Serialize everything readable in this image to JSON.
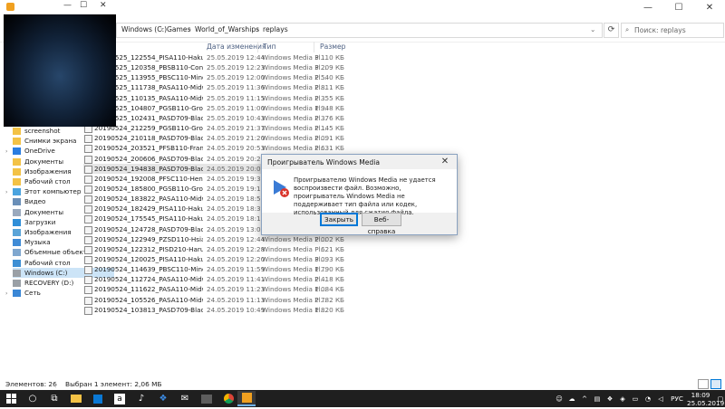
{
  "address": {
    "crumbs": [
      "Windows (C:)",
      "Games",
      "World_of_Warships",
      "replays"
    ],
    "search_placeholder": "Поиск: replays"
  },
  "columns": {
    "name": "",
    "date": "Дата изменения",
    "type": "Тип",
    "size": "Размер"
  },
  "files": [
    {
      "name": "20190525_122554_PISA110-Hakuryu_47_...",
      "date": "25.05.2019 12:44",
      "type": "Windows Media Pl...",
      "size": "3 110 КБ"
    },
    {
      "name": "20190525_120358_PBSB110-Conqueror_5...",
      "date": "25.05.2019 12:23",
      "type": "Windows Media Pl...",
      "size": "3 209 КБ"
    },
    {
      "name": "20190525_113955_PBSC110-Minotaur_35...",
      "date": "25.05.2019 12:00",
      "type": "Windows Media Pl...",
      "size": "2 540 КБ"
    },
    {
      "name": "20190525_111738_PASA110-Midway_45_...",
      "date": "25.05.2019 11:36",
      "type": "Windows Media Pl...",
      "size": "2 811 КБ"
    },
    {
      "name": "20190525_110135_PASA110-Midway_19_...",
      "date": "25.05.2019 11:15",
      "type": "Windows Media Pl...",
      "size": "2 355 КБ"
    },
    {
      "name": "20190525_104807_PGSB110-Grossdeutsc...",
      "date": "25.05.2019 11:00",
      "type": "Windows Media Pl...",
      "size": "1 948 КБ"
    },
    {
      "name": "20190525_102431_PASD709-Black_28_na...",
      "date": "25.05.2019 10:43",
      "type": "Windows Media Pl...",
      "size": "2 376 КБ"
    },
    {
      "name": "20190524_212259_PGSB110-Grossdeutsc...",
      "date": "24.05.2019 21:37",
      "type": "Windows Media Pl...",
      "size": "2 145 КБ"
    },
    {
      "name": "20190524_210118_PASD709-Black_16_OC...",
      "date": "24.05.2019 21:20",
      "type": "Windows Media Pl...",
      "size": "2 091 КБ"
    },
    {
      "name": "20190524_203521_PFSB110-France_50_G...",
      "date": "24.05.2019 20:53",
      "type": "Windows Media Pl...",
      "size": "2 631 КБ"
    },
    {
      "name": "20190524_200606_PASD709-Black_16_OC...",
      "date": "24.05.2019 20:22",
      "type": "Windows Media Pl...",
      "size": "2 140 КБ"
    },
    {
      "name": "20190524_194838_PASD709-Black_16_OC...",
      "date": "24.05.2019 20:03",
      "type": "Windows Media Pl...",
      "size": "2 112 КБ"
    },
    {
      "name": "20190524_192008_PFSC110-Henri-IV_18_...",
      "date": "24.05.2019 19:34",
      "type": "Windows Media Pl...",
      "size": "2 140 КБ"
    },
    {
      "name": "20190524_185800_PGSB110-Grossdeutsc...",
      "date": "24.05.2019 19:17",
      "type": "Windows Media Pl...",
      "size": "2 306 КБ"
    },
    {
      "name": "20190524_183822_PASA110-Midway_22_...",
      "date": "24.05.2019 18:56",
      "type": "Windows Media Pl...",
      "size": "2 222 КБ"
    },
    {
      "name": "20190524_182429_PISA110-Hakuryu_16_...",
      "date": "24.05.2019 18:32",
      "type": "Windows Media Pl...",
      "size": "1 760 КБ"
    },
    {
      "name": "20190524_175545_PISA110-Hakuryu_16_...",
      "date": "24.05.2019 18:16",
      "type": "Windows Media Pl...",
      "size": "2 100 КБ"
    },
    {
      "name": "20190524_124728_PASD709-Black_35_NE...",
      "date": "24.05.2019 13:03",
      "type": "Windows Media Pl...",
      "size": "2 429 КБ"
    },
    {
      "name": "20190524_122949_PZSD110-Hsiang-Yan...",
      "date": "24.05.2019 12:44",
      "type": "Windows Media Pl...",
      "size": "2 002 КБ"
    },
    {
      "name": "20190524_122312_PISD210-Harugumo_2...",
      "date": "24.05.2019 12:28",
      "type": "Windows Media Pl...",
      "size": "621 КБ"
    },
    {
      "name": "20190524_120025_PISA110-Hakuryu_35_...",
      "date": "24.05.2019 12:20",
      "type": "Windows Media Pl...",
      "size": "3 093 КБ"
    },
    {
      "name": "20190524_114639_PBSC110-Minotaur_00...",
      "date": "24.05.2019 11:59",
      "type": "Windows Media Pl...",
      "size": "1 790 КБ"
    },
    {
      "name": "20190524_112724_PASA110-Midway_38_...",
      "date": "24.05.2019 11:41",
      "type": "Windows Media Pl...",
      "size": "2 418 КБ"
    },
    {
      "name": "20190524_111622_PASA110-Midway_14_...",
      "date": "24.05.2019 11:23",
      "type": "Windows Media Pl...",
      "size": "1 084 КБ"
    },
    {
      "name": "20190524_105526_PASA110-Midway_18_...",
      "date": "24.05.2019 11:13",
      "type": "Windows Media Pl...",
      "size": "2 782 КБ"
    },
    {
      "name": "20190524_103813_PASD709-Black_44_Pat...",
      "date": "24.05.2019 10:49",
      "type": "Windows Media Pl...",
      "size": "1 820 КБ"
    }
  ],
  "sidebar": [
    {
      "label": "screenshot",
      "icon": "folder-icon",
      "chev": ""
    },
    {
      "label": "Снимки экрана",
      "icon": "folder-icon",
      "chev": ""
    },
    {
      "label": "OneDrive",
      "icon": "cloud-icon",
      "chev": "›"
    },
    {
      "label": "Документы",
      "icon": "folder-icon",
      "chev": ""
    },
    {
      "label": "Изображения",
      "icon": "folder-icon",
      "chev": ""
    },
    {
      "label": "Рабочий стол",
      "icon": "folder-icon",
      "chev": ""
    },
    {
      "label": "Этот компьютер",
      "icon": "computer-icon",
      "chev": "›"
    },
    {
      "label": "Видео",
      "icon": "video-folder-icon",
      "chev": ""
    },
    {
      "label": "Документы",
      "icon": "documents-folder-icon",
      "chev": ""
    },
    {
      "label": "Загрузки",
      "icon": "downloads-folder-icon",
      "chev": ""
    },
    {
      "label": "Изображения",
      "icon": "pictures-folder-icon",
      "chev": ""
    },
    {
      "label": "Музыка",
      "icon": "music-folder-icon",
      "chev": ""
    },
    {
      "label": "Объемные объекты",
      "icon": "3d-objects-icon",
      "chev": ""
    },
    {
      "label": "Рабочий стол",
      "icon": "desktop-folder-icon",
      "chev": ""
    },
    {
      "label": "Windows (C:)",
      "icon": "drive-icon",
      "chev": ""
    },
    {
      "label": "RECOVERY (D:)",
      "icon": "drive-icon",
      "chev": ""
    },
    {
      "label": "Сеть",
      "icon": "network-icon",
      "chev": "›"
    }
  ],
  "dialog": {
    "title": "Проигрыватель Windows Media",
    "message": "Проигрывателю Windows Media не удается воспроизвести файл. Возможно, проигрыватель Windows Media не поддерживает тип файла или кодек, использованный для сжатия файла.",
    "close_button": "Закрыть",
    "help_button": "Веб-справка"
  },
  "status": {
    "items_count": "Элементов: 26",
    "selected": "Выбран 1 элемент: 2,06 МБ"
  },
  "taskbar": {
    "language": "РУС",
    "time": "18:09",
    "date": "25.05.2019"
  },
  "colors": {
    "selection": "#e5e5e5",
    "nav_selected": "#cce4f7",
    "taskbar": "#1f1f1f",
    "accent": "#0078d7"
  }
}
